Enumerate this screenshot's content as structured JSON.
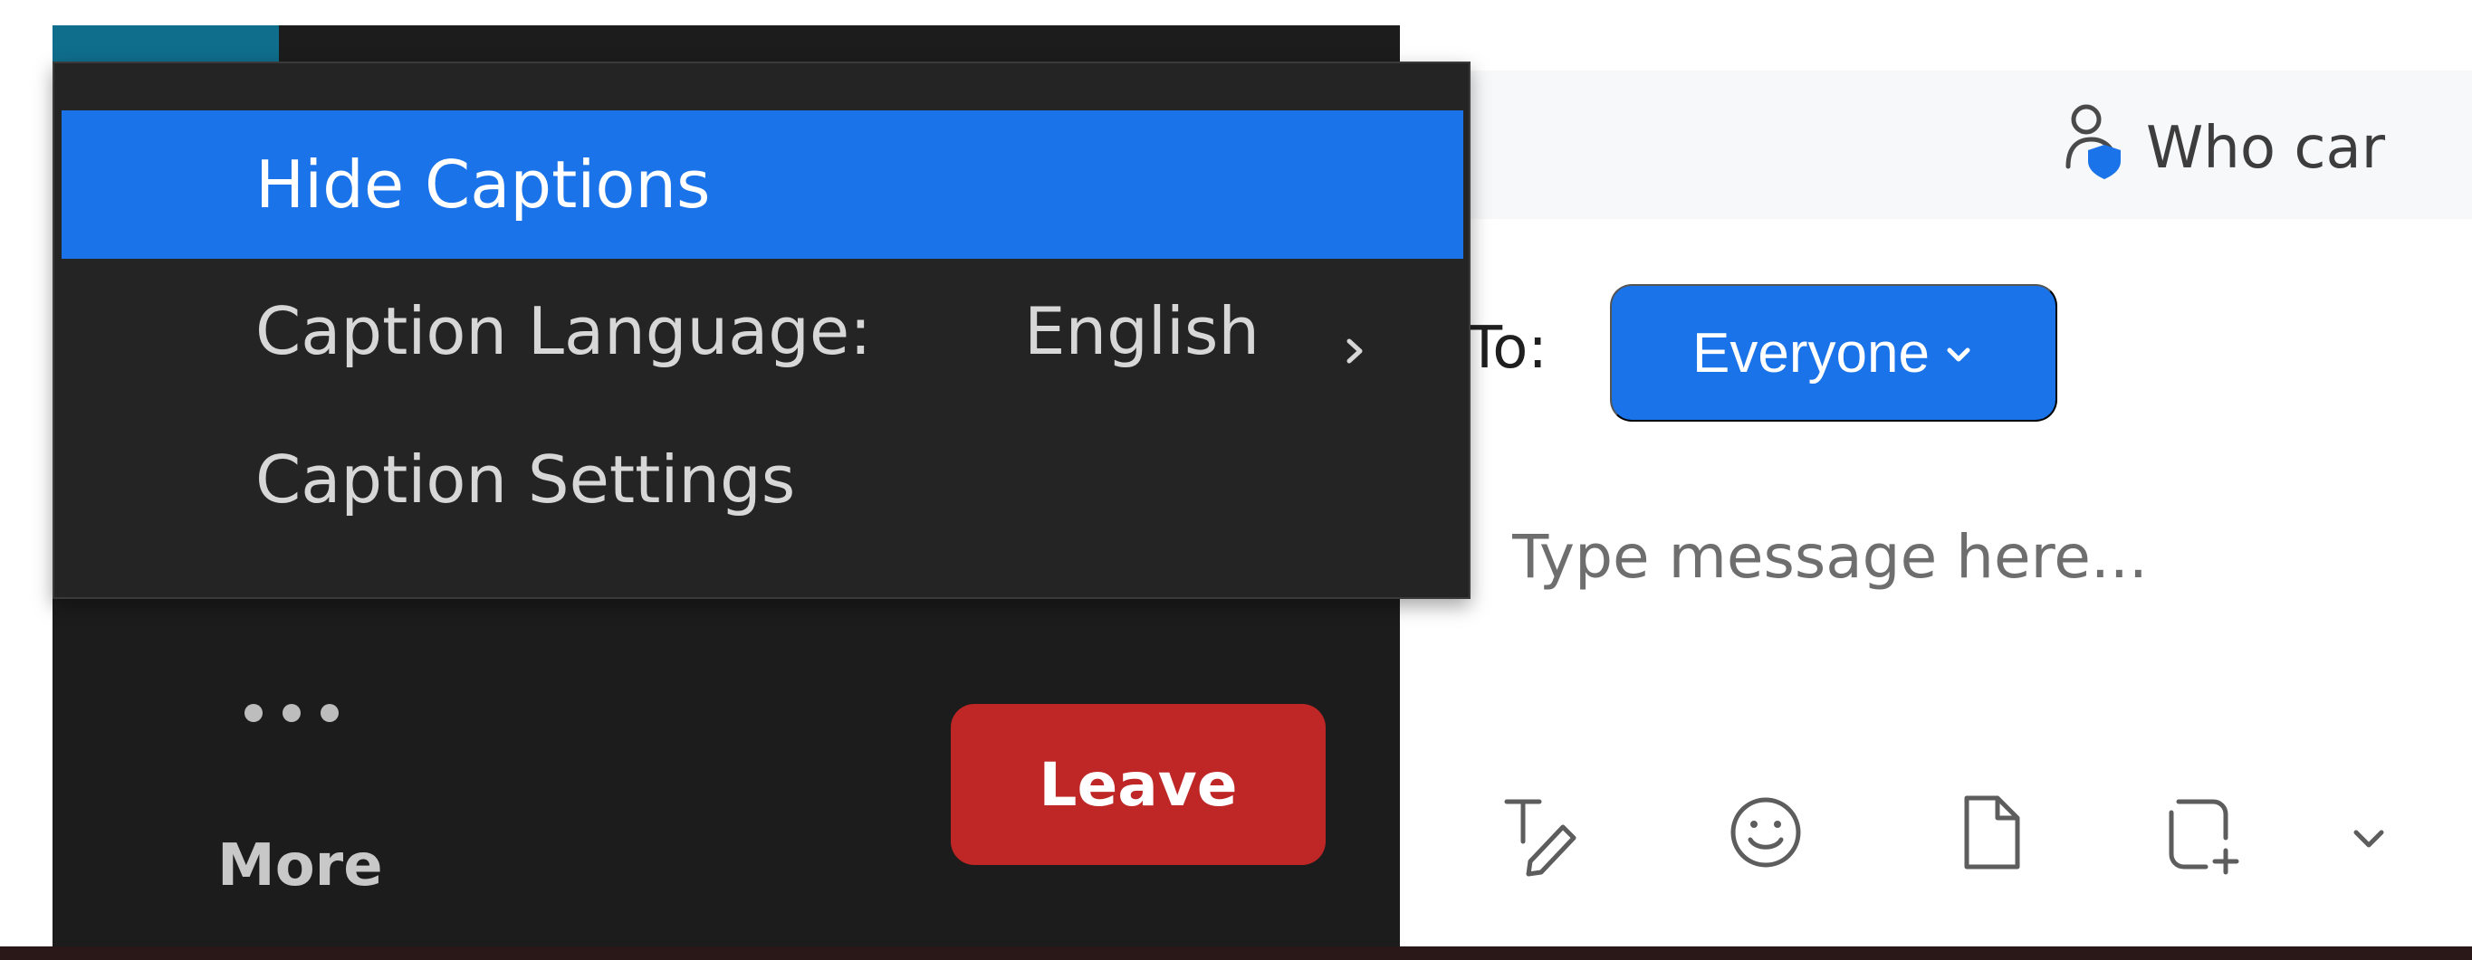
{
  "menu": {
    "items": [
      {
        "label": "Hide Captions",
        "selected": true
      },
      {
        "label": "Caption Language:",
        "value": "English",
        "submenu": true
      },
      {
        "label": "Caption Settings"
      }
    ],
    "submenu_icon": "chevron-right-icon"
  },
  "chat": {
    "who_can_see": {
      "icon": "user-shield-icon",
      "label": "Who car"
    },
    "recipient": {
      "label": "To:",
      "value": "Everyone",
      "icon": "chevron-down-icon"
    },
    "input": {
      "placeholder": "Type message here..."
    },
    "toolbar": {
      "icons": [
        "text-format-icon",
        "emoji-icon",
        "file-icon",
        "screenshot-icon",
        "chevron-down-icon"
      ]
    }
  },
  "controls": {
    "more_label": "More",
    "leave_label": "Leave"
  },
  "colors": {
    "accent": "#1a73e8",
    "leave": "#bf2626",
    "panel": "#1c1c1c",
    "menu": "#242424"
  }
}
